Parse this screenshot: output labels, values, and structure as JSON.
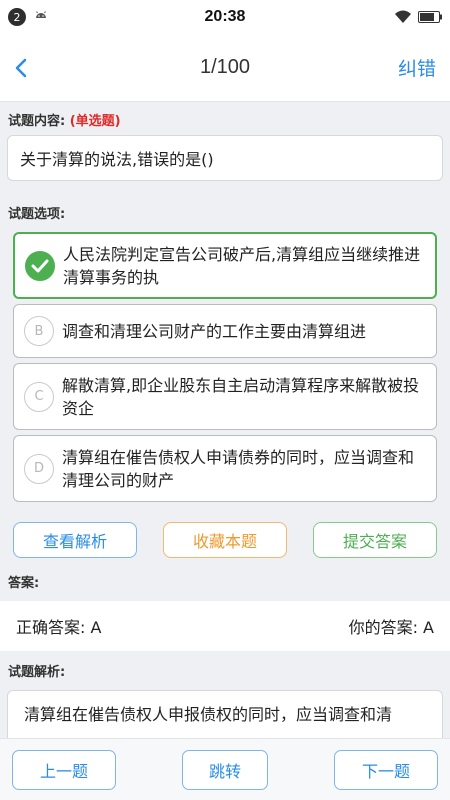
{
  "status_bar": {
    "notification_count": "2",
    "time": "20:38"
  },
  "nav": {
    "progress": "1/100",
    "report_label": "纠错"
  },
  "question": {
    "content_label": "试题内容:",
    "type_label": "(单选题)",
    "text": "关于清算的说法,错误的是()"
  },
  "options_label": "试题选项:",
  "options": [
    {
      "marker": "A",
      "text": "人民法院判定宣告公司破产后,清算组应当继续推进清算事务的执",
      "correct": true
    },
    {
      "marker": "B",
      "text": "调查和清理公司财产的工作主要由清算组进",
      "correct": false
    },
    {
      "marker": "C",
      "text": "解散清算,即企业股东自主启动清算程序来解散被投资企",
      "correct": false
    },
    {
      "marker": "D",
      "text": "清算组在催告债权人申请债券的同时，应当调查和清理公司的财产",
      "correct": false
    }
  ],
  "actions": {
    "view_analysis": "查看解析",
    "favorite": "收藏本题",
    "submit": "提交答案"
  },
  "answer": {
    "section_label": "答案:",
    "correct_answer": "正确答案: A",
    "your_answer": "你的答案: A"
  },
  "analysis": {
    "section_label": "试题解析:",
    "text": "清算组在催告债权人申报债权的同时，应当调查和清"
  },
  "bottom": {
    "prev": "上一题",
    "jump": "跳转",
    "next": "下一题"
  },
  "colors": {
    "accent_blue": "#2a8de8",
    "correct_green": "#4caf50",
    "favorite_orange": "#ef9a2e",
    "type_red": "#e02a2a"
  }
}
